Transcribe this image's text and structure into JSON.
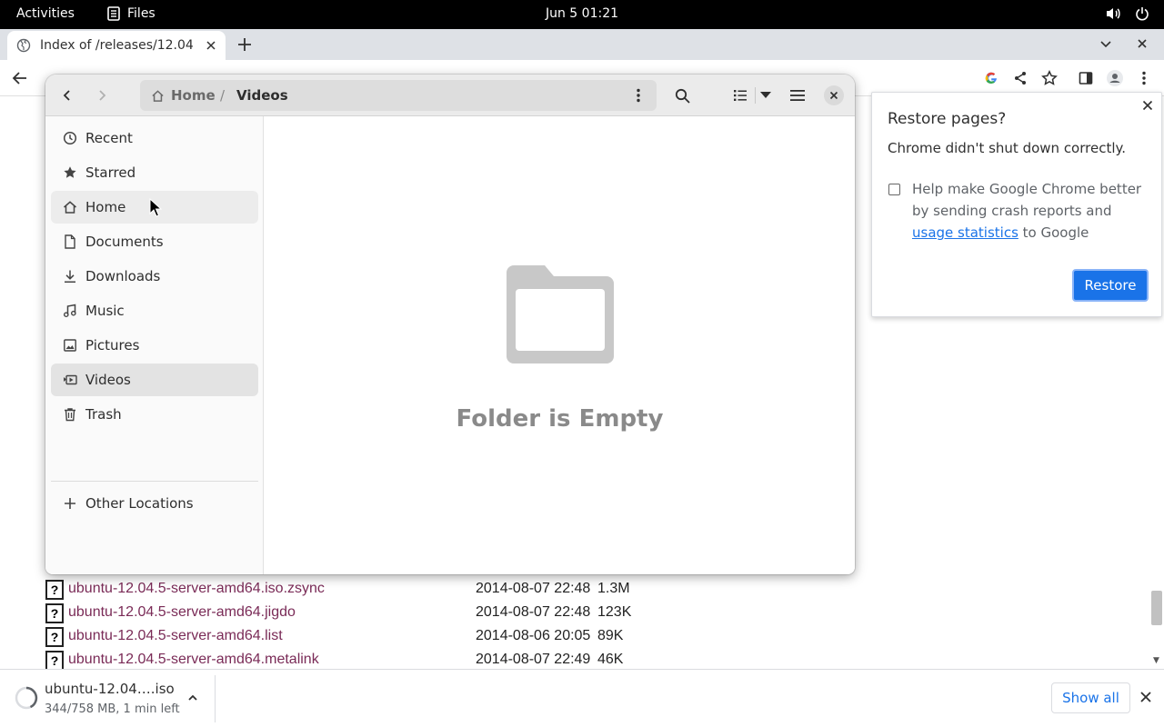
{
  "topbar": {
    "activities": "Activities",
    "app_name": "Files",
    "clock": "Jun 5  01:21"
  },
  "browser": {
    "tab_title": "Index of /releases/12.04"
  },
  "listing": {
    "rows": [
      {
        "name": "ubuntu-12.04.5-server-amd64.iso.zsync",
        "date": "2014-08-07 22:48",
        "size": "1.3M"
      },
      {
        "name": "ubuntu-12.04.5-server-amd64.jigdo",
        "date": "2014-08-07 22:48",
        "size": "123K"
      },
      {
        "name": "ubuntu-12.04.5-server-amd64.list",
        "date": "2014-08-06 20:05",
        "size": "89K"
      },
      {
        "name": "ubuntu-12.04.5-server-amd64.metalink",
        "date": "2014-08-07 22:49",
        "size": "46K"
      }
    ]
  },
  "download": {
    "file": "ubuntu-12.04….iso",
    "status": "344/758 MB, 1 min left",
    "show_all": "Show all"
  },
  "restore": {
    "title": "Restore pages?",
    "message": "Chrome didn't shut down correctly.",
    "help_prefix": "Help make Google Chrome better by sending crash reports and ",
    "help_link": "usage statistics",
    "help_suffix": " to Google",
    "button": "Restore"
  },
  "files": {
    "path_home": "Home",
    "path_current": "Videos",
    "sidebar": [
      {
        "label": "Recent",
        "icon": "clock-icon"
      },
      {
        "label": "Starred",
        "icon": "star-icon"
      },
      {
        "label": "Home",
        "icon": "home-icon"
      },
      {
        "label": "Documents",
        "icon": "document-icon"
      },
      {
        "label": "Downloads",
        "icon": "download-icon"
      },
      {
        "label": "Music",
        "icon": "music-icon"
      },
      {
        "label": "Pictures",
        "icon": "picture-icon"
      },
      {
        "label": "Videos",
        "icon": "video-icon"
      },
      {
        "label": "Trash",
        "icon": "trash-icon"
      }
    ],
    "other_locations": "Other Locations",
    "empty_text": "Folder is Empty"
  }
}
